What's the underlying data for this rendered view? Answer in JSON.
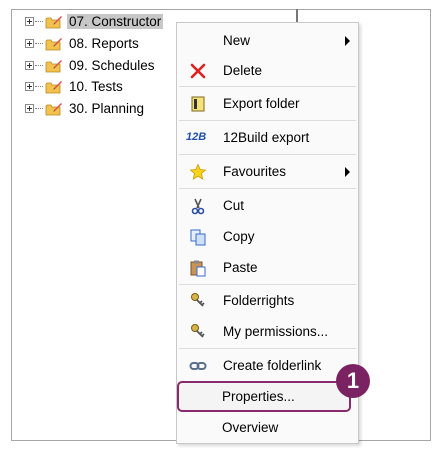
{
  "tree": {
    "items": [
      {
        "label": "07. Constructor",
        "selected": true
      },
      {
        "label": "08. Reports",
        "selected": false
      },
      {
        "label": "09. Schedules",
        "selected": false
      },
      {
        "label": "10. Tests",
        "selected": false
      },
      {
        "label": "30. Planning",
        "selected": false
      }
    ],
    "folder_icon": "folder-with-pencil-icon"
  },
  "context_menu": {
    "items": [
      {
        "label": "New",
        "icon": "none",
        "submenu": true
      },
      {
        "label": "Delete",
        "icon": "red-x-icon",
        "submenu": false
      },
      {
        "label": "Export folder",
        "icon": "export-folder-icon",
        "submenu": false
      },
      {
        "label": "12Build export",
        "icon": "12build-logo-icon",
        "submenu": false
      },
      {
        "label": "Favourites",
        "icon": "star-icon",
        "submenu": true
      },
      {
        "label": "Cut",
        "icon": "scissors-icon",
        "submenu": false
      },
      {
        "label": "Copy",
        "icon": "copy-icon",
        "submenu": false
      },
      {
        "label": "Paste",
        "icon": "paste-icon",
        "submenu": false
      },
      {
        "label": "Folderrights",
        "icon": "keys-icon",
        "submenu": false
      },
      {
        "label": "My permissions...",
        "icon": "keys-icon",
        "submenu": false
      },
      {
        "label": "Create folderlink",
        "icon": "link-icon",
        "submenu": false
      },
      {
        "label": "Properties...",
        "icon": "none",
        "submenu": false,
        "highlighted": true
      },
      {
        "label": "Overview",
        "icon": "none",
        "submenu": false
      }
    ],
    "icon_12build_text": "12B"
  },
  "callout": {
    "step_number": "1",
    "color": "#7b2362"
  }
}
